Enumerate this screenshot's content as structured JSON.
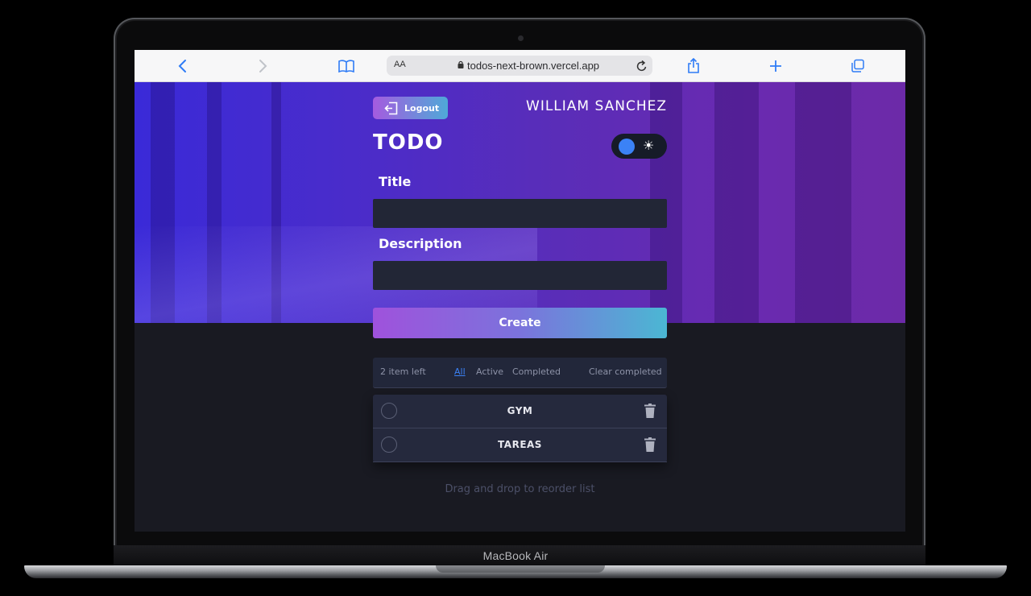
{
  "device": {
    "label": "MacBook Air"
  },
  "browser": {
    "text_size_label": "AA",
    "url": "todos-next-brown.vercel.app",
    "icons": [
      "back-icon",
      "forward-icon",
      "reader-icon",
      "lock-icon",
      "reload-icon",
      "share-icon",
      "new-tab-icon",
      "tabs-icon"
    ]
  },
  "app": {
    "logout_label": "Logout",
    "user_name": "WILLIAM SANCHEZ",
    "title": "TODO",
    "theme_toggle": {
      "state": "dark",
      "icon": "sun-icon"
    },
    "form": {
      "title_label": "Title",
      "title_value": "",
      "description_label": "Description",
      "description_value": "",
      "create_label": "Create"
    },
    "filters": {
      "items_left": "2 item left",
      "all": "All",
      "active": "Active",
      "completed": "Completed",
      "clear_completed": "Clear completed",
      "selected": "All"
    },
    "todos": [
      {
        "text": "GYM",
        "completed": false
      },
      {
        "text": "TAREAS",
        "completed": false
      }
    ],
    "hint": "Drag and drop to reorder list"
  },
  "colors": {
    "accent": "#3b82f6",
    "gradient_start": "#a55bdf",
    "gradient_end": "#4fa9d8",
    "panel_bg": "#25293d",
    "page_bg": "#191a22"
  }
}
